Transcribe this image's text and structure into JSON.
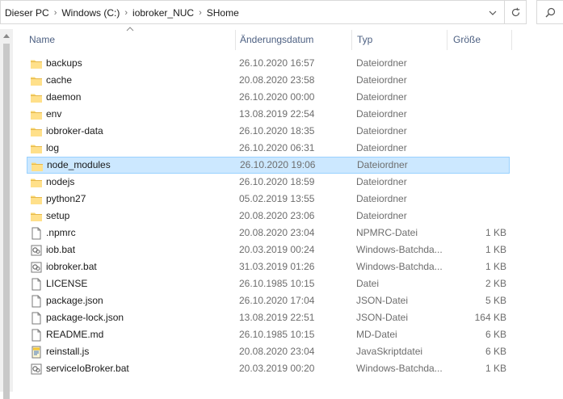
{
  "address_bar": {
    "crumbs": [
      "Dieser PC",
      "Windows  (C:)",
      "iobroker_NUC",
      "SHome"
    ]
  },
  "columns": {
    "name": "Name",
    "date": "Änderungsdatum",
    "type": "Typ",
    "size": "Größe"
  },
  "files": [
    {
      "name": "backups",
      "date": "26.10.2020 16:57",
      "type": "Dateiordner",
      "size": "",
      "icon": "folder-icon"
    },
    {
      "name": "cache",
      "date": "20.08.2020 23:58",
      "type": "Dateiordner",
      "size": "",
      "icon": "folder-icon"
    },
    {
      "name": "daemon",
      "date": "26.10.2020 00:00",
      "type": "Dateiordner",
      "size": "",
      "icon": "folder-icon"
    },
    {
      "name": "env",
      "date": "13.08.2019 22:54",
      "type": "Dateiordner",
      "size": "",
      "icon": "folder-icon"
    },
    {
      "name": "iobroker-data",
      "date": "26.10.2020 18:35",
      "type": "Dateiordner",
      "size": "",
      "icon": "folder-icon"
    },
    {
      "name": "log",
      "date": "26.10.2020 06:31",
      "type": "Dateiordner",
      "size": "",
      "icon": "folder-icon"
    },
    {
      "name": "node_modules",
      "date": "26.10.2020 19:06",
      "type": "Dateiordner",
      "size": "",
      "icon": "folder-icon",
      "selected": true
    },
    {
      "name": "nodejs",
      "date": "26.10.2020 18:59",
      "type": "Dateiordner",
      "size": "",
      "icon": "folder-icon"
    },
    {
      "name": "python27",
      "date": "05.02.2019 13:55",
      "type": "Dateiordner",
      "size": "",
      "icon": "folder-icon"
    },
    {
      "name": "setup",
      "date": "20.08.2020 23:06",
      "type": "Dateiordner",
      "size": "",
      "icon": "folder-icon"
    },
    {
      "name": ".npmrc",
      "date": "20.08.2020 23:04",
      "type": "NPMRC-Datei",
      "size": "1 KB",
      "icon": "file-icon"
    },
    {
      "name": "iob.bat",
      "date": "20.03.2019 00:24",
      "type": "Windows-Batchda...",
      "size": "1 KB",
      "icon": "batch-file-icon"
    },
    {
      "name": "iobroker.bat",
      "date": "31.03.2019 01:26",
      "type": "Windows-Batchda...",
      "size": "1 KB",
      "icon": "batch-file-icon"
    },
    {
      "name": "LICENSE",
      "date": "26.10.1985 10:15",
      "type": "Datei",
      "size": "2 KB",
      "icon": "file-icon"
    },
    {
      "name": "package.json",
      "date": "26.10.2020 17:04",
      "type": "JSON-Datei",
      "size": "5 KB",
      "icon": "file-icon"
    },
    {
      "name": "package-lock.json",
      "date": "13.08.2019 22:51",
      "type": "JSON-Datei",
      "size": "164 KB",
      "icon": "file-icon"
    },
    {
      "name": "README.md",
      "date": "26.10.1985 10:15",
      "type": "MD-Datei",
      "size": "6 KB",
      "icon": "file-icon"
    },
    {
      "name": "reinstall.js",
      "date": "20.08.2020 23:04",
      "type": "JavaSkriptdatei",
      "size": "6 KB",
      "icon": "script-file-icon"
    },
    {
      "name": "serviceIoBroker.bat",
      "date": "20.03.2019 00:20",
      "type": "Windows-Batchda...",
      "size": "1 KB",
      "icon": "batch-file-icon"
    }
  ],
  "colors": {
    "selection_bg": "#cce8ff",
    "selection_border": "#99d1ff",
    "folder": "#f8d775",
    "header_text": "#4d6082"
  }
}
